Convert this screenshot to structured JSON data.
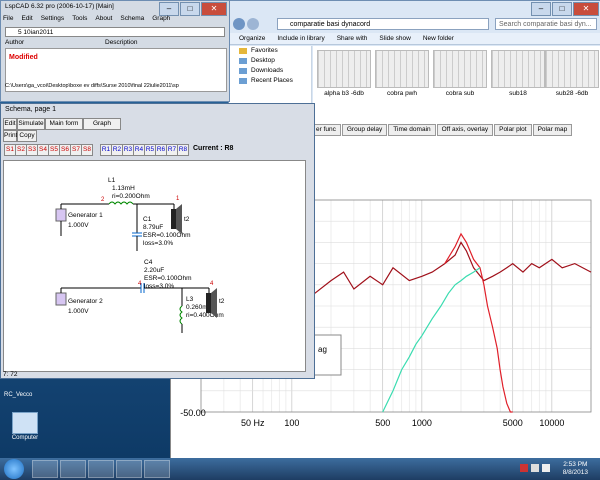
{
  "desktop": {
    "icons": [
      {
        "label": "Computer"
      }
    ],
    "left_label": "RC_Vecco"
  },
  "explorer": {
    "address": "comparatie basi dynacord",
    "search_placeholder": "Search comparatie basi dyn...",
    "toolbar": [
      "Organize",
      "Include in library",
      "Share with",
      "Slide show",
      "New folder"
    ],
    "nav": [
      {
        "label": "Favorites"
      },
      {
        "label": "Desktop"
      },
      {
        "label": "Downloads"
      },
      {
        "label": "Recent Places"
      }
    ],
    "files": [
      {
        "label": "alpha b3 -6db"
      },
      {
        "label": "cobra pwh"
      },
      {
        "label": "cobra sub"
      },
      {
        "label": "sub18"
      },
      {
        "label": "sub28 -6db"
      }
    ]
  },
  "lspcad": {
    "title": "LspCAD 6.32 pro (2006-10-17) [Main]",
    "menu": [
      "File",
      "Edit",
      "Settings",
      "Tools",
      "About",
      "Schema",
      "Graph"
    ],
    "combo": "5 10ian2011",
    "col_author": "Author",
    "col_description": "Description",
    "modified": "Modified",
    "path": "C:\\Users\\ga_vcoi\\Desktop\\boxe ev diffs\\Surse 2010\\final 22iulie2011\\sp"
  },
  "schema": {
    "title": "Schema, page 1",
    "menu": [
      "Edit",
      "Simulate",
      "Main form",
      "Graph"
    ],
    "menu2": [
      "Print",
      "Copy"
    ],
    "sources": [
      "S1",
      "S2",
      "S3",
      "S4",
      "S5",
      "S6",
      "S7",
      "S8"
    ],
    "responses": [
      "R1",
      "R2",
      "R3",
      "R4",
      "R5",
      "R6",
      "R7",
      "R8"
    ],
    "current_label": "Current : R8",
    "status": "7: 72",
    "components": {
      "gen1": "Generator 1",
      "gen1_v": "1.000V",
      "gen2": "Generator 2",
      "gen2_v": "1.000V",
      "l1": "L1",
      "l1_val": "1.13mH",
      "l1_ri": "ri=0.200Ohm",
      "c1": "C1",
      "c1_val": "8.79uF",
      "c1_esr": "ESR=0.100Ohm",
      "c1_loss": "loss=3.0%",
      "c4": "C4",
      "c4_val": "2.20uF",
      "c4_esr": "ESR=0.100Ohm",
      "c4_loss": "loss=3.0%",
      "l3": "L3",
      "l3_val": "0.260mH",
      "l3_ri": "ri=0.400Ohm",
      "spk1": "t2",
      "spk2": "t2",
      "node": "4",
      "node2": "4",
      "node3": "2",
      "node4": "1"
    }
  },
  "graph": {
    "tabs": [
      "er func",
      "Group delay",
      "Time domain",
      "Off axis, overlay",
      "Polar plot",
      "Polar map"
    ],
    "y_label": "-50.00",
    "x_ticks": [
      "50 Hz",
      "100",
      "500",
      "1000",
      "5000",
      "10000"
    ],
    "box_text": "ag"
  },
  "chart_data": {
    "type": "line",
    "xlabel": "",
    "ylabel": "",
    "x_scale": "log",
    "xlim": [
      20,
      20000
    ],
    "ylim": [
      -50,
      0
    ],
    "grid": true,
    "series": [
      {
        "color": "#a0101a",
        "x": [
          20,
          30,
          40,
          50,
          60,
          70,
          80,
          90,
          100,
          120,
          150,
          200,
          250,
          300,
          400,
          500,
          600,
          800,
          1000,
          1200,
          1500,
          1800,
          2000,
          2200,
          2500,
          3000,
          3500,
          4000,
          4500,
          5000,
          6000,
          7000,
          8000,
          10000,
          12000,
          15000,
          20000
        ],
        "y": [
          -20,
          -23,
          -18,
          -21,
          -17,
          -22,
          -19,
          -16,
          -20,
          -18,
          -22,
          -19,
          -17,
          -21,
          -18,
          -20,
          -16,
          -19,
          -18,
          -17,
          -15,
          -13,
          -10,
          -12,
          -16,
          -19,
          -18,
          -17,
          -16,
          -15,
          -17,
          -15,
          -16,
          -14,
          -16,
          -15,
          -17
        ]
      },
      {
        "color": "#e0202a",
        "x": [
          1500,
          1800,
          2000,
          2200,
          2500,
          2800,
          3000,
          3200,
          3500,
          3800,
          4000,
          4200,
          4500,
          4800,
          5000
        ],
        "y": [
          -15,
          -11,
          -8,
          -10,
          -14,
          -16,
          -20,
          -25,
          -30,
          -35,
          -40,
          -44,
          -48,
          -50,
          -50
        ]
      },
      {
        "color": "#3adcb0",
        "x": [
          500,
          600,
          700,
          800,
          900,
          1000,
          1200,
          1400,
          1600,
          1800,
          2000,
          2200,
          2500,
          2800
        ],
        "y": [
          -50,
          -45,
          -40,
          -37,
          -34,
          -32,
          -28,
          -25,
          -22,
          -20,
          -19,
          -18,
          -17,
          -16
        ]
      }
    ]
  },
  "taskbar": {
    "time": "2:53 PM",
    "date": "8/8/2013"
  }
}
